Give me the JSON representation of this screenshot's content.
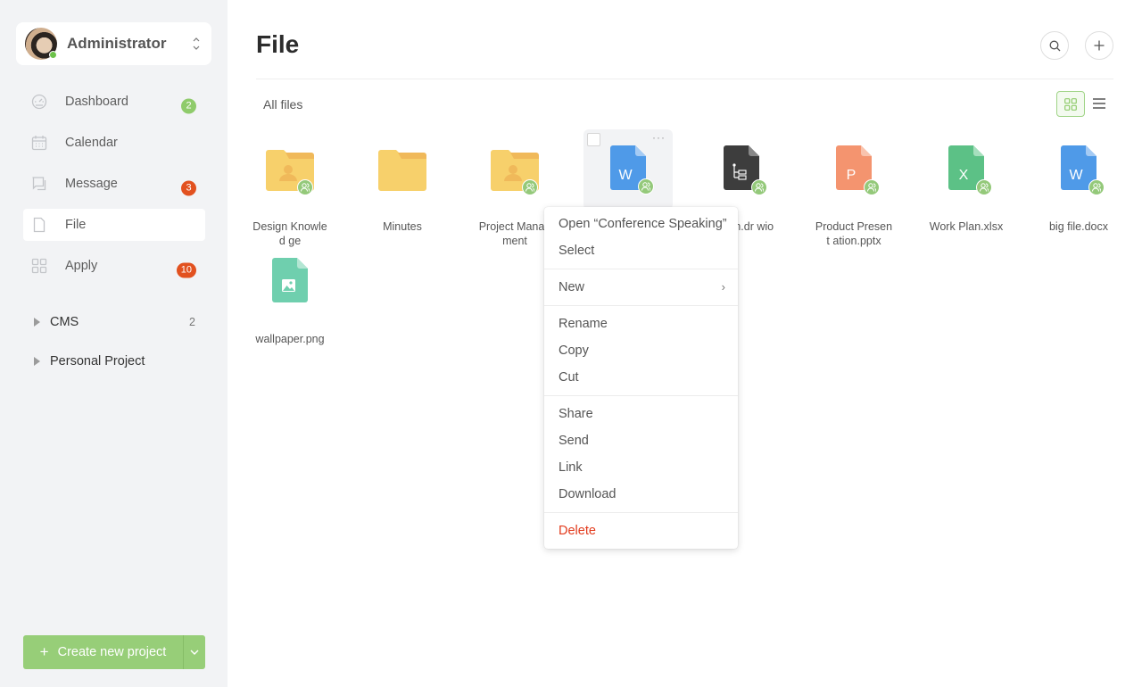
{
  "account": {
    "name": "Administrator",
    "status": "online"
  },
  "sidebar": {
    "items": [
      {
        "label": "Dashboard",
        "icon": "dashboard-icon",
        "badge": "2",
        "badge_color": "#8fcb6b"
      },
      {
        "label": "Calendar",
        "icon": "calendar-icon",
        "badge": null
      },
      {
        "label": "Message",
        "icon": "message-icon",
        "badge": "3",
        "badge_color": "#e2511f"
      },
      {
        "label": "File",
        "icon": "file-icon",
        "badge": null,
        "active": true
      },
      {
        "label": "Apply",
        "icon": "apps-icon",
        "badge": "10",
        "badge_color": "#e2511f"
      }
    ],
    "groups": [
      {
        "label": "CMS",
        "count": "2"
      },
      {
        "label": "Personal Project",
        "count": ""
      }
    ],
    "create_button": "Create new project"
  },
  "header": {
    "title": "File",
    "search_icon": "search-icon",
    "add_icon": "plus-icon"
  },
  "toolbar": {
    "breadcrumb": "All files",
    "view_mode": "grid"
  },
  "files": [
    {
      "name": "Design Knowledge",
      "display": "Design Knowled ge",
      "type": "shared-folder",
      "shared": true
    },
    {
      "name": "Minutes",
      "display": "Minutes",
      "type": "folder",
      "shared": false
    },
    {
      "name": "Project Management",
      "display": "Project Manag ment",
      "type": "shared-folder",
      "shared": true
    },
    {
      "name": "Conference Speaking",
      "display": "",
      "type": "docx",
      "letter": "W",
      "shared": true,
      "selected": true
    },
    {
      "name": "diagram.drawio",
      "display": "agram.dr wio",
      "type": "drawio",
      "shared": true
    },
    {
      "name": "Product Presentation.pptx",
      "display": "Product Present ation.pptx",
      "type": "pptx",
      "letter": "P",
      "shared": true
    },
    {
      "name": "Work Plan.xlsx",
      "display": "Work Plan.xlsx",
      "type": "xlsx",
      "letter": "X",
      "shared": true
    },
    {
      "name": "big file.docx",
      "display": "big file.docx",
      "type": "docx",
      "letter": "W",
      "shared": true
    },
    {
      "name": "wallpaper.png",
      "display": "wallpaper.png",
      "type": "image",
      "shared": false
    }
  ],
  "context_menu": {
    "open": "Open “Conference Speaking”",
    "select": "Select",
    "new": "New",
    "rename": "Rename",
    "copy": "Copy",
    "cut": "Cut",
    "share": "Share",
    "send": "Send",
    "link": "Link",
    "download": "Download",
    "delete": "Delete"
  },
  "colors": {
    "accent": "#8fcb6b",
    "danger": "#e23a1c",
    "folder": "#f7d06b",
    "word": "#4f9ae8",
    "powerpoint": "#f4946f",
    "excel": "#5cc186",
    "image": "#6fcfae",
    "drawio": "#3d3d3d"
  }
}
